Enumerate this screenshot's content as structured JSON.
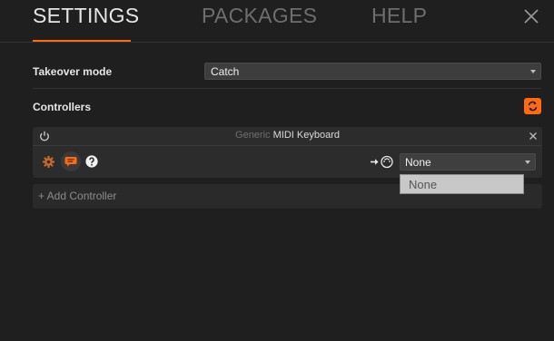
{
  "tabs": [
    {
      "label": "SETTINGS",
      "active": true
    },
    {
      "label": "PACKAGES",
      "active": false
    },
    {
      "label": "HELP",
      "active": false
    }
  ],
  "colors": {
    "accent": "#ff6a13",
    "background": "#1f1f1f",
    "card": "#2c2c2c"
  },
  "takeover": {
    "label": "Takeover mode",
    "value": "Catch"
  },
  "controllers": {
    "label": "Controllers",
    "refresh_icon": "refresh-icon"
  },
  "card": {
    "vendor": "Generic",
    "model": "MIDI Keyboard",
    "port_select_value": "None",
    "icons": [
      "power-icon",
      "close-icon",
      "gear-icon",
      "chat-icon",
      "help-icon",
      "midi-in-icon"
    ]
  },
  "add_controller": {
    "label": "+ Add Controller"
  },
  "dropdown": {
    "options": [
      "None"
    ]
  }
}
